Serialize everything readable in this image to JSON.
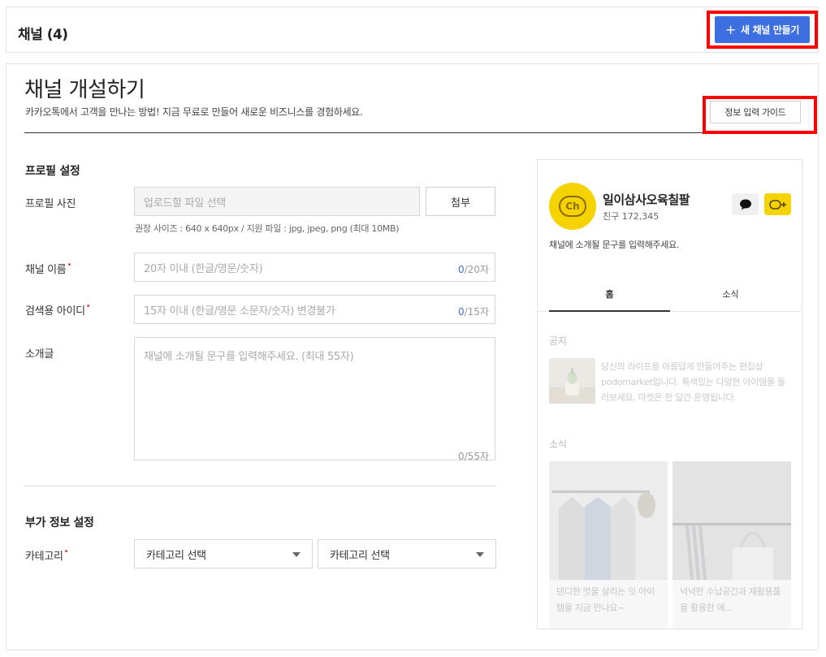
{
  "header": {
    "title": "채널 (4)",
    "new_channel_button": "새 채널 만들기",
    "plus_glyph": "+"
  },
  "page": {
    "title": "채널 개설하기",
    "subtitle": "카카오톡에서 고객을 만나는 방법! 지금 무료로 만들어 새로운 비즈니스를 경험하세요.",
    "guide_button": "정보 입력 가이드"
  },
  "profile_section": {
    "title": "프로필 설정",
    "photo": {
      "label": "프로필 사진",
      "placeholder": "업로드할 파일 선택",
      "attach_button": "첨부",
      "hint": "권장 사이즈 : 640 x 640px / 지원 파일 : jpg, jpeg, png (최대 10MB)"
    },
    "channel_name": {
      "label": "채널 이름",
      "required": "•",
      "placeholder": "20자 이내 (한글/영문/숫자)",
      "count": "0",
      "max": "/20자"
    },
    "search_id": {
      "label": "검색용 아이디",
      "required": "•",
      "placeholder": "15자 이내 (한글/영문 소문자/숫자) 변경불가",
      "count": "0",
      "max": "/15자"
    },
    "intro": {
      "label": "소개글",
      "placeholder": "채널에 소개될 문구를 입력해주세요. (최대 55자)",
      "counter": "0/55자"
    }
  },
  "extra_section": {
    "title": "부가 정보 설정",
    "category": {
      "label": "카테고리",
      "required": "•",
      "select1": "카테고리 선택",
      "select2": "카테고리 선택"
    }
  },
  "preview": {
    "avatar_text": "Ch",
    "name": "일이삼사오육칠팔",
    "friends": "친구 172,345",
    "description": "채널에 소개될 문구를 입력해주세요.",
    "tabs": [
      "홈",
      "소식"
    ],
    "notice_title": "공지",
    "notice_text": "당신의 라이프를 아름답게 만들어주는 편집샵 podomarket입니다. 특색있는 다양한 아이템을 둘러보세요. 마켓은 한 달간 운영됩니다.",
    "news_title": "소식",
    "cards": [
      {
        "text": "댄디한 멋을 살리는 잇 아이템을 지금 만나요~"
      },
      {
        "text": "넉넉한 수납공간과 재활용품을 활용한 에..."
      }
    ]
  },
  "colors": {
    "accent": "#3d6fe0",
    "highlight_box": "#ff0000",
    "kakao_yellow": "#f5d300",
    "required_dot": "#e03a2c"
  }
}
